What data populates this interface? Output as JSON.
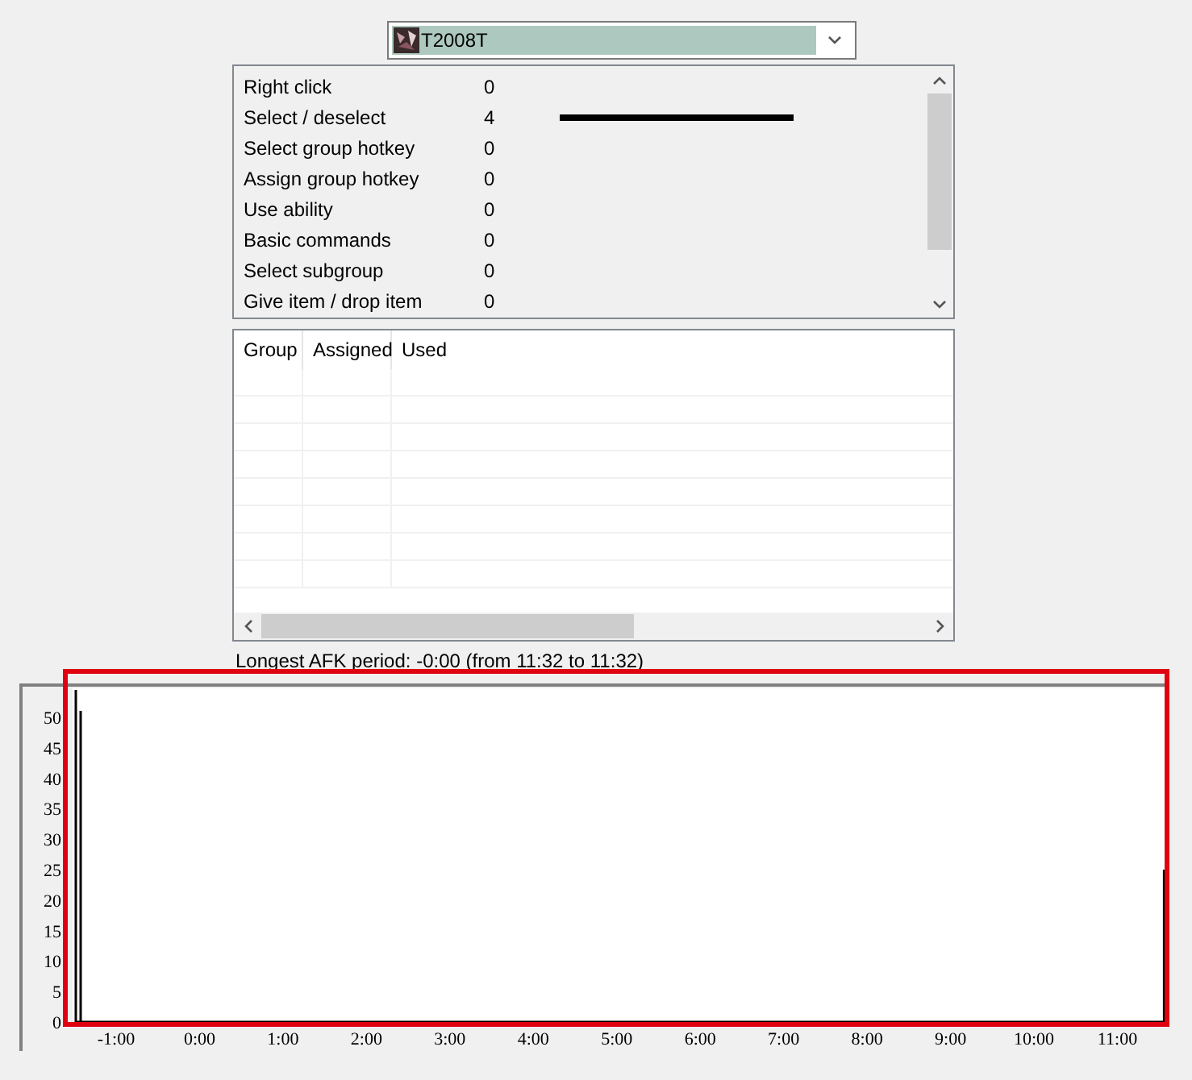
{
  "player_select": {
    "value": "T2008T"
  },
  "actions": [
    {
      "name": "Right click",
      "count": "0"
    },
    {
      "name": "Select / deselect",
      "count": "4",
      "level": 0.68
    },
    {
      "name": "Select group hotkey",
      "count": "0"
    },
    {
      "name": "Assign group hotkey",
      "count": "0"
    },
    {
      "name": "Use ability",
      "count": "0"
    },
    {
      "name": "Basic commands",
      "count": "0"
    },
    {
      "name": "Select subgroup",
      "count": "0"
    },
    {
      "name": "Give item / drop item",
      "count": "0"
    }
  ],
  "group_table": {
    "columns": [
      "Group",
      "Assigned",
      "Used"
    ]
  },
  "afk_text": "Longest AFK period: -0:00 (from 11:32 to 11:32)",
  "activity_chart": {
    "highlighted": true,
    "y_labels": [
      "50",
      "45",
      "40",
      "35",
      "30",
      "25",
      "20",
      "15",
      "10",
      "5",
      "0"
    ],
    "x_labels": [
      "-1:00",
      "0:00",
      "1:00",
      "2:00",
      "3:00",
      "4:00",
      "5:00",
      "6:00",
      "7:00",
      "8:00",
      "9:00",
      "10:00",
      "11:00"
    ]
  }
}
